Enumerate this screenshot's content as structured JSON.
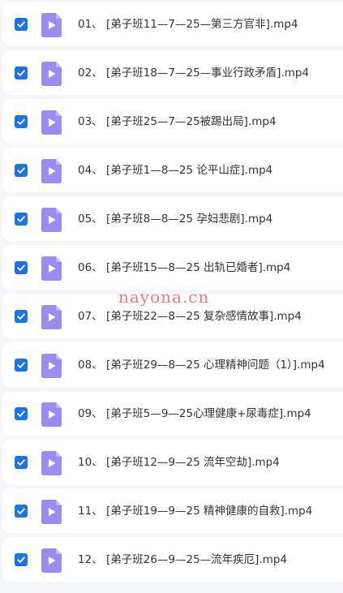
{
  "colors": {
    "checkbox": "#1a73e8",
    "file_icon": "#9a8cf2",
    "row_background": "#ffffff",
    "page_background": "#f5f6fa",
    "watermark": "#e8636b"
  },
  "icons": {
    "checkbox": "checkmark-icon",
    "file": "video-file-icon"
  },
  "files": [
    {
      "name": "01、 [弟子班11—7—25—第三方官非].mp4",
      "checked": true
    },
    {
      "name": "02、 [弟子班18—7—25—事业行政矛盾].mp4",
      "checked": true
    },
    {
      "name": "03、 [弟子班25—7—25被踢出局].mp4",
      "checked": true
    },
    {
      "name": "04、 [弟子班1—8—25 论平山症].mp4",
      "checked": true
    },
    {
      "name": "05、 [弟子班8—8—25 孕妇悲剧].mp4",
      "checked": true
    },
    {
      "name": "06、 [弟子班15—8—25 出轨已婚者].mp4",
      "checked": true
    },
    {
      "name": "07、 [弟子班22—8—25 复杂感情故事].mp4",
      "checked": true
    },
    {
      "name": "08、 [弟子班29—8—25 心理精神问题（1）].mp4",
      "checked": true
    },
    {
      "name": "09、 [弟子班5—9—25心理健康+尿毒症].mp4",
      "checked": true
    },
    {
      "name": "10、 [弟子班12—9—25 流年空劫].mp4",
      "checked": true
    },
    {
      "name": "11、 [弟子班19—9—25 精神健康的自救].mp4",
      "checked": true
    },
    {
      "name": "12、 [弟子班26—9—25—流年疾厄].mp4",
      "checked": true
    }
  ],
  "watermark": {
    "text": "nayona.cn"
  }
}
